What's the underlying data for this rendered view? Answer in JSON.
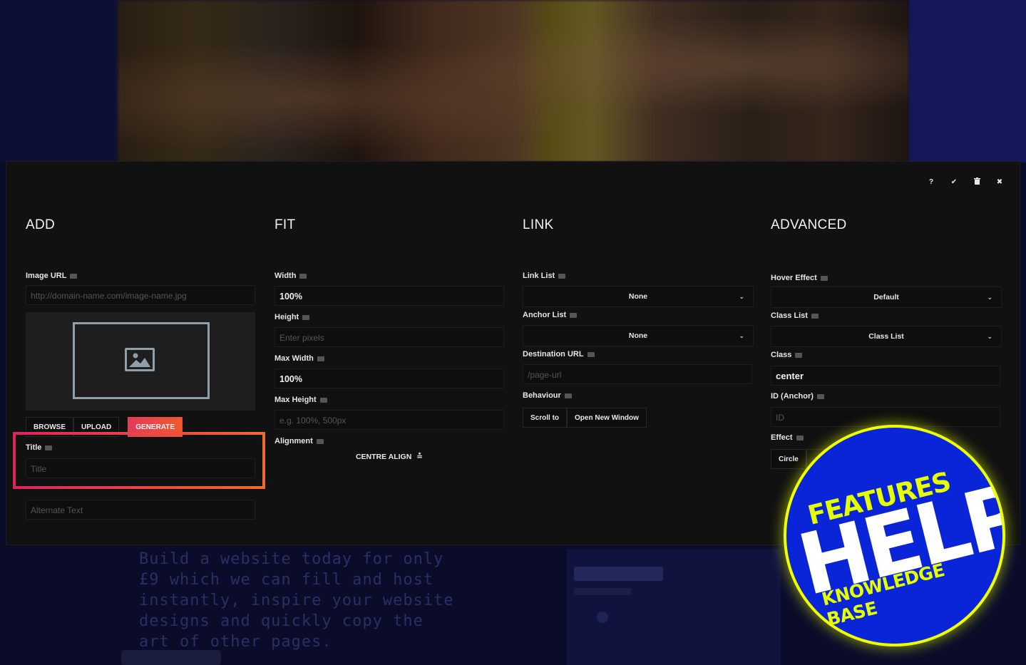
{
  "background": {
    "body_text": "Build a website today for only £9 which we can fill and host instantly, inspire your website designs and quickly copy the art of other pages."
  },
  "toolbar": {
    "help": "?",
    "confirm": "✔",
    "delete": "🗑",
    "close": "✖"
  },
  "add": {
    "heading": "ADD",
    "image_url_label": "Image URL",
    "image_url_placeholder": "http://domain-name.com/image-name.jpg",
    "browse": "BROWSE",
    "upload": "UPLOAD",
    "generate": "GENERATE",
    "title_label": "Title",
    "title_placeholder": "Title",
    "alt_placeholder": "Alternate Text"
  },
  "fit": {
    "heading": "FIT",
    "width_label": "Width",
    "width_value": "100%",
    "height_label": "Height",
    "height_placeholder": "Enter pixels",
    "max_width_label": "Max Width",
    "max_width_value": "100%",
    "max_height_label": "Max Height",
    "max_height_placeholder": "e.g. 100%, 500px",
    "alignment_label": "Alignment",
    "alignment_value": "CENTRE ALIGN"
  },
  "link": {
    "heading": "LINK",
    "link_list_label": "Link List",
    "link_list_value": "None",
    "anchor_list_label": "Anchor List",
    "anchor_list_value": "None",
    "destination_label": "Destination URL",
    "destination_placeholder": "/page-url",
    "behaviour_label": "Behaviour",
    "scroll_to": "Scroll to",
    "open_new_window": "Open New Window"
  },
  "advanced": {
    "heading": "ADVANCED",
    "hover_effect_label": "Hover Effect",
    "hover_effect_value": "Default",
    "class_list_label": "Class List",
    "class_list_value": "Class List",
    "class_label": "Class",
    "class_value": "center",
    "id_label": "ID (Anchor)",
    "id_placeholder": "ID",
    "effect_label": "Effect",
    "effect_circle": "Circle"
  },
  "badge": {
    "line1": "FEATURES",
    "line2": "HELP",
    "line3": "KNOWLEDGE BASE"
  },
  "colors": {
    "modal_bg": "#111111",
    "accent_start": "#e0225e",
    "accent_end": "#f06a2a",
    "badge_blue": "#0a25d8",
    "badge_yellow": "#e6ff00"
  }
}
